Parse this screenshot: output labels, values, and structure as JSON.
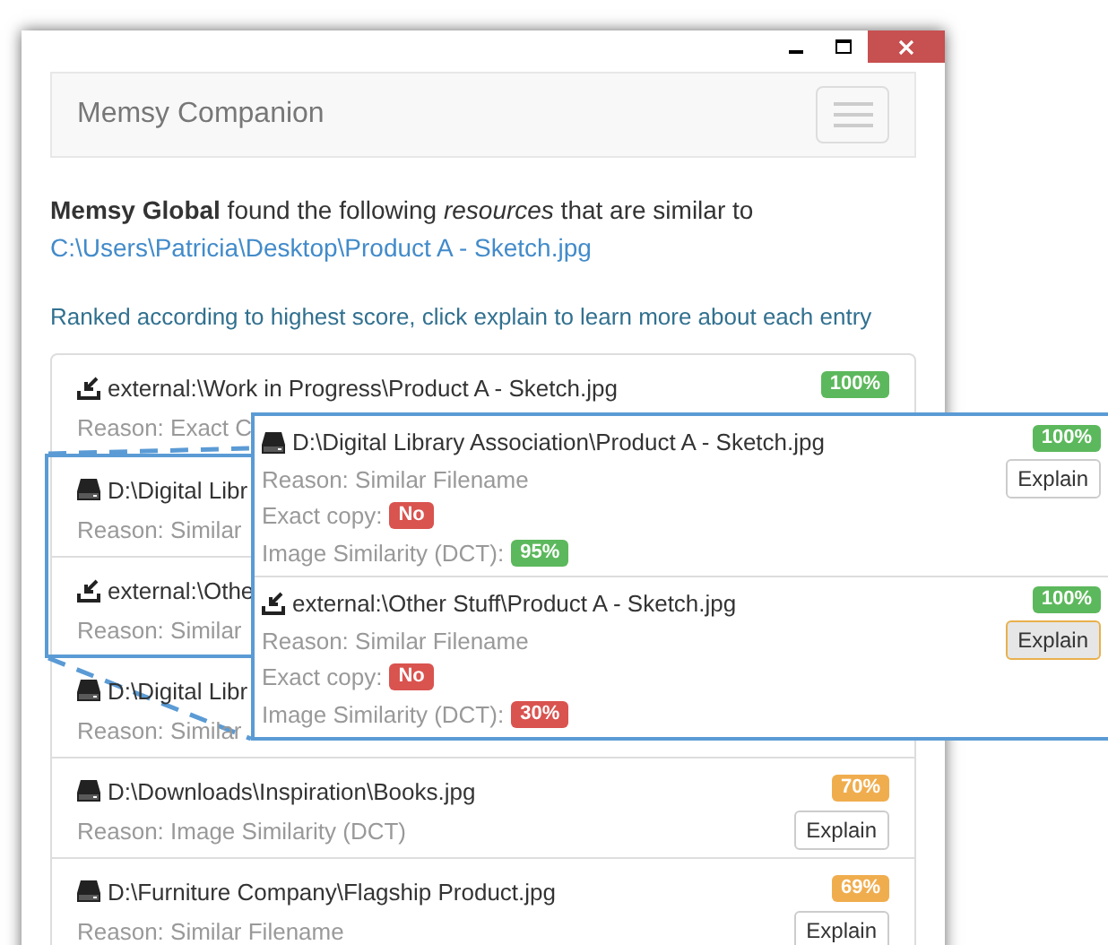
{
  "navbar": {
    "brand": "Memsy Companion"
  },
  "intro": {
    "text": "**Memsy Global** found the following *resources* that are similar to",
    "link": "C:\\Users\\Patricia\\Desktop\\Product A - Sketch.jpg"
  },
  "hint": "Ranked according to highest score, click explain to learn more about each entry",
  "results": [
    {
      "kind": "external",
      "path": "external:\\Work in Progress\\Product A - Sketch.jpg",
      "reason": "Reason: Exact C",
      "score": {
        "text": "100%",
        "color": "#5cb85c"
      }
    },
    {
      "kind": "drive",
      "path": "D:\\Digital Libr",
      "reason": "Reason: Similar"
    },
    {
      "kind": "external",
      "path": "external:\\Othe",
      "reason": "Reason: Similar"
    },
    {
      "kind": "drive",
      "path": "D:\\Digital Libr",
      "reason": "Reason: Similar"
    },
    {
      "kind": "drive",
      "path": "D:\\Downloads\\Inspiration\\Books.jpg",
      "reason": "Reason: Image Similarity (DCT)",
      "score": {
        "text": "70%",
        "color": "#f0ad4e"
      },
      "explain": "Explain"
    },
    {
      "kind": "drive",
      "path": "D:\\Furniture Company\\Flagship Product.jpg",
      "reason": "Reason: Similar Filename",
      "score": {
        "text": "69%",
        "color": "#f0ad4e"
      },
      "explain": "Explain"
    }
  ],
  "callout": {
    "items": [
      {
        "kind": "drive",
        "path": "D:\\Digital Library Association\\Product A - Sketch.jpg",
        "reason": "Reason: Similar Filename",
        "exact_label": "Exact copy:",
        "exact": {
          "text": "No",
          "color": "#d9534f"
        },
        "similarity_label": "Image Similarity (DCT):",
        "similarity": {
          "text": "95%",
          "color": "#5cb85c"
        },
        "score": {
          "text": "100%",
          "color": "#5cb85c"
        },
        "explain": "Explain",
        "focused": false
      },
      {
        "kind": "external",
        "path": "external:\\Other Stuff\\Product A - Sketch.jpg",
        "reason": "Reason: Similar Filename",
        "exact_label": "Exact copy:",
        "exact": {
          "text": "No",
          "color": "#d9534f"
        },
        "similarity_label": "Image Similarity (DCT):",
        "similarity": {
          "text": "30%",
          "color": "#d9534f"
        },
        "score": {
          "text": "100%",
          "color": "#5cb85c"
        },
        "explain": "Explain",
        "focused": true
      }
    ]
  }
}
